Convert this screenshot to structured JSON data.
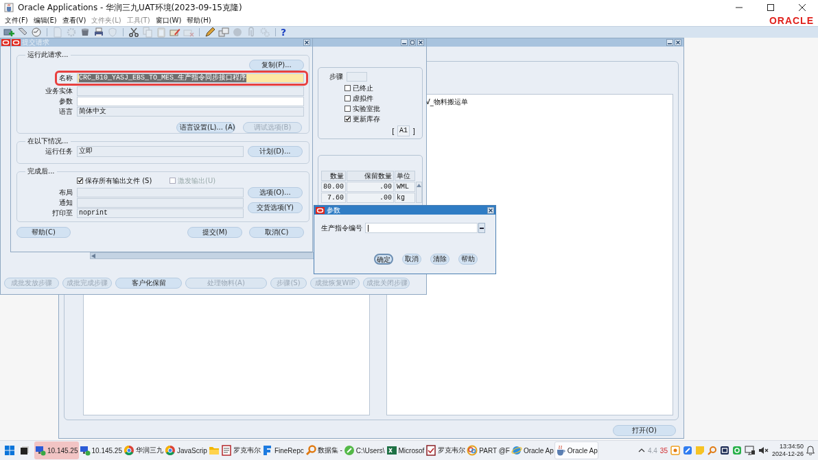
{
  "window": {
    "title": "Oracle Applications - 华润三九UAT环境(2023-09-15克隆)"
  },
  "menu": [
    {
      "label": "文件(F)",
      "disabled": false
    },
    {
      "label": "编辑(E)",
      "disabled": false
    },
    {
      "label": "查看(V)",
      "disabled": false
    },
    {
      "label": "文件夹(L)",
      "disabled": true
    },
    {
      "label": "工具(T)",
      "disabled": true
    },
    {
      "label": "窗口(W)",
      "disabled": false
    },
    {
      "label": "帮助(H)",
      "disabled": false
    }
  ],
  "logo": "ORACLE",
  "toolbar": {
    "groups": [
      [
        {
          "kind": "add",
          "disabled": false
        },
        {
          "kind": "find",
          "disabled": false
        },
        {
          "kind": "dial",
          "disabled": false
        }
      ],
      [
        {
          "kind": "page",
          "disabled": true
        },
        {
          "kind": "gear",
          "disabled": true
        },
        {
          "kind": "cup",
          "disabled": false
        },
        {
          "kind": "printer",
          "disabled": false
        },
        {
          "kind": "shield",
          "disabled": true
        }
      ],
      [
        {
          "kind": "scissors",
          "disabled": false
        },
        {
          "kind": "copy",
          "disabled": true
        },
        {
          "kind": "paste",
          "disabled": true
        },
        {
          "kind": "pencard",
          "disabled": false
        },
        {
          "kind": "cardx",
          "disabled": true
        }
      ],
      [
        {
          "kind": "pen",
          "disabled": false
        },
        {
          "kind": "boxes",
          "disabled": false
        },
        {
          "kind": "sphere",
          "disabled": true
        },
        {
          "kind": "clip",
          "disabled": true
        },
        {
          "kind": "gears",
          "disabled": true
        }
      ]
    ],
    "help": "?"
  },
  "material_window": {
    "list_item": "V_物料搬运单",
    "open_button": "打开(O)"
  },
  "batch_window": {
    "step_label": "步骤",
    "flags": [
      {
        "label": "已终止",
        "checked": false
      },
      {
        "label": "虚拟件",
        "checked": false
      },
      {
        "label": "实验室批",
        "checked": false
      },
      {
        "label": "更新库存",
        "checked": true
      }
    ],
    "bracket_open": "[",
    "code": "A1",
    "bracket_close": "]",
    "table": {
      "columns": [
        "数量",
        "保留数量",
        "单位"
      ],
      "rows": [
        [
          "80.00",
          ".00",
          "WML"
        ],
        [
          "7.60",
          ".00",
          "kg"
        ]
      ]
    },
    "buttons": [
      {
        "label": "成批发放步骤",
        "disabled": true
      },
      {
        "label": "成批完成步骤",
        "disabled": true
      },
      {
        "label": "客户化保留",
        "disabled": false
      },
      {
        "label": "处理物料(A)",
        "disabled": true
      },
      {
        "label": "步骤(S)",
        "disabled": true
      },
      {
        "label": "成批恢复WIP",
        "disabled": true
      },
      {
        "label": "成批关闭步骤",
        "disabled": true
      }
    ]
  },
  "submit_dialog": {
    "title": "提交请求",
    "run_group": {
      "legend": "运行此请求...",
      "copy_button": "复制(P)...",
      "fields": [
        {
          "label": "名称",
          "value": "CRC_B10_YASJ_EBS_TO_MES_生产指令同步接口程序",
          "focused": true,
          "editable": true
        },
        {
          "label": "业务实体",
          "focused": false,
          "editable": false
        },
        {
          "label": "参数",
          "focused": false,
          "editable": true
        },
        {
          "label": "语言",
          "value": "简体中文",
          "focused": false,
          "editable": false
        }
      ],
      "buttons": [
        {
          "label": "语言设置(L)... (A)",
          "disabled": false
        },
        {
          "label": "调试选项(B)",
          "disabled": true
        }
      ]
    },
    "schedule_group": {
      "legend": "在以下情况...",
      "label": "运行任务",
      "value": "立即",
      "button": "计划(D)..."
    },
    "completion_group": {
      "legend": "完成后...",
      "options": [
        {
          "label": "保存所有输出文件 (S)",
          "checked": true,
          "disabled": false
        },
        {
          "label": "激发输出(U)",
          "checked": false,
          "disabled": true
        }
      ],
      "fields": [
        {
          "label": "布局"
        },
        {
          "label": "通知"
        },
        {
          "label": "打印至",
          "value": "noprint"
        }
      ],
      "buttons": [
        "选项(O)...",
        "交货选项(Y)"
      ]
    },
    "buttons": [
      "帮助(C)",
      "提交(M)",
      "取消(C)"
    ]
  },
  "parameters_dialog": {
    "title": "参数",
    "label": "生产指令编号",
    "focused": true,
    "buttons": [
      {
        "label": "确定",
        "default": true
      },
      {
        "label": "取消",
        "default": false
      },
      {
        "label": "清除",
        "default": false
      },
      {
        "label": "帮助",
        "default": false
      }
    ]
  },
  "taskbar": {
    "apps": [
      {
        "kind": "monitor",
        "label": "10.145.25",
        "selected": false,
        "flashing": true
      },
      {
        "kind": "monitor",
        "label": "10.145.25",
        "selected": false,
        "flashing": false
      },
      {
        "kind": "browser",
        "label": "华润三九",
        "selected": false,
        "flashing": false
      },
      {
        "kind": "browser",
        "label": "JavaScrip",
        "selected": false,
        "flashing": false
      },
      {
        "kind": "folder",
        "selected": false,
        "flashing": false
      },
      {
        "kind": "form",
        "label": "罗克韦尔",
        "selected": false,
        "flashing": false
      },
      {
        "kind": "bars",
        "label": "FineRepc",
        "selected": false,
        "flashing": false
      },
      {
        "kind": "magnifier",
        "label": "数据集 -",
        "selected": false,
        "flashing": false
      },
      {
        "kind": "slash",
        "label": "C:\\Users\\",
        "selected": false,
        "flashing": false
      },
      {
        "kind": "sheet",
        "label": "Microsof",
        "selected": false,
        "flashing": false
      },
      {
        "kind": "checkform",
        "label": "罗克韦尔",
        "selected": false,
        "flashing": false
      },
      {
        "kind": "swirl",
        "label": "PART @F",
        "selected": false,
        "flashing": false
      },
      {
        "kind": "globe",
        "label": "Oracle Ap",
        "selected": false,
        "flashing": false
      },
      {
        "kind": "cup",
        "label": "Oracle Ap",
        "selected": true,
        "flashing": false
      }
    ],
    "tray": {
      "dim_reading": "4.4",
      "count": "35"
    },
    "time": "13:34:50",
    "date": "2024-12-26"
  }
}
